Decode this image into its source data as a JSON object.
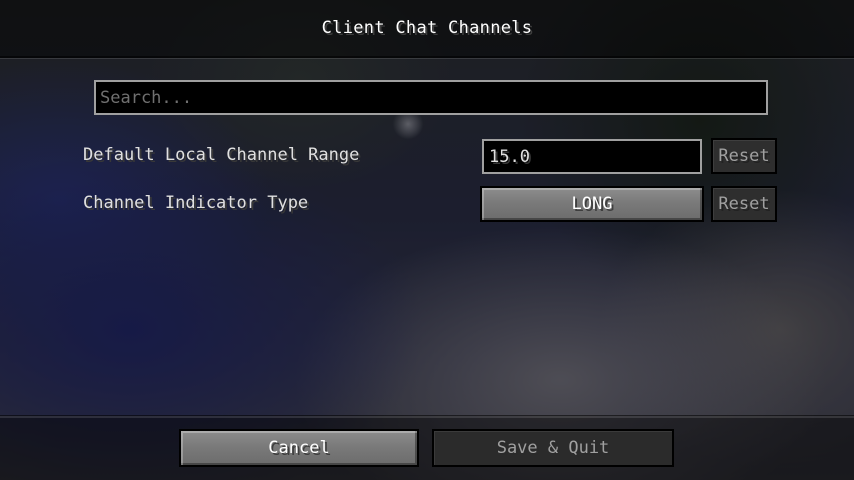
{
  "screen": {
    "title": "Client Chat Channels"
  },
  "search": {
    "placeholder": "Search...",
    "value": ""
  },
  "settings": [
    {
      "label": "Default Local Channel Range",
      "value": "15.0",
      "reset_label": "Reset"
    },
    {
      "label": "Channel Indicator Type",
      "value": "LONG",
      "reset_label": "Reset"
    }
  ],
  "footer": {
    "cancel_label": "Cancel",
    "save_label": "Save & Quit"
  }
}
